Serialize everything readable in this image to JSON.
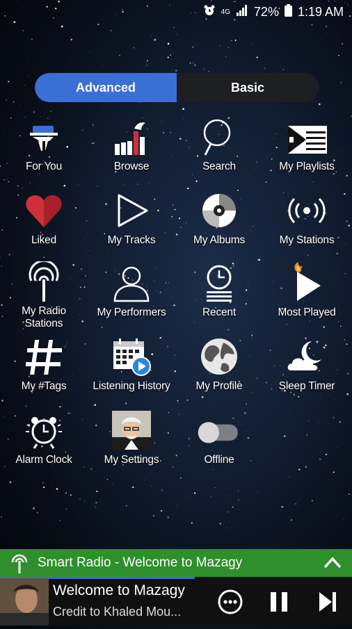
{
  "status": {
    "network": "4G",
    "battery": "72%",
    "time": "1:19 AM"
  },
  "toggle": {
    "advanced": "Advanced",
    "basic": "Basic"
  },
  "tiles": [
    {
      "label": "For You",
      "icon": "butler-icon"
    },
    {
      "label": "Browse",
      "icon": "bars-chart-icon"
    },
    {
      "label": "Search",
      "icon": "search-icon"
    },
    {
      "label": "My Playlists",
      "icon": "playlist-flag-icon"
    },
    {
      "label": "Liked",
      "icon": "heart-icon"
    },
    {
      "label": "My Tracks",
      "icon": "play-outline-icon"
    },
    {
      "label": "My Albums",
      "icon": "disc-icon"
    },
    {
      "label": "My Stations",
      "icon": "broadcast-icon"
    },
    {
      "label": "My Radio Stations",
      "icon": "radio-tower-icon"
    },
    {
      "label": "My Performers",
      "icon": "person-icon"
    },
    {
      "label": "Recent",
      "icon": "clock-stack-icon"
    },
    {
      "label": "Most Played",
      "icon": "play-fire-icon"
    },
    {
      "label": "My #Tags",
      "icon": "hashtag-icon"
    },
    {
      "label": "Listening History",
      "icon": "calendar-play-icon"
    },
    {
      "label": "My Profile",
      "icon": "globe-icon"
    },
    {
      "label": "Sleep Timer",
      "icon": "moon-cloud-icon"
    },
    {
      "label": "Alarm Clock",
      "icon": "alarm-clock-icon"
    },
    {
      "label": "My Settings",
      "icon": "settings-avatar-icon"
    },
    {
      "label": "Offline",
      "icon": "toggle-switch-icon"
    }
  ],
  "mini_player": {
    "title": "Smart Radio - Welcome to Mazagy"
  },
  "now_playing": {
    "title": "Welcome to Mazagy",
    "subtitle": "Credit to Khaled Mou..."
  },
  "colors": {
    "accent": "#3a6fd6",
    "radio_green": "#2f8f2d",
    "heart": "#d0303b"
  }
}
